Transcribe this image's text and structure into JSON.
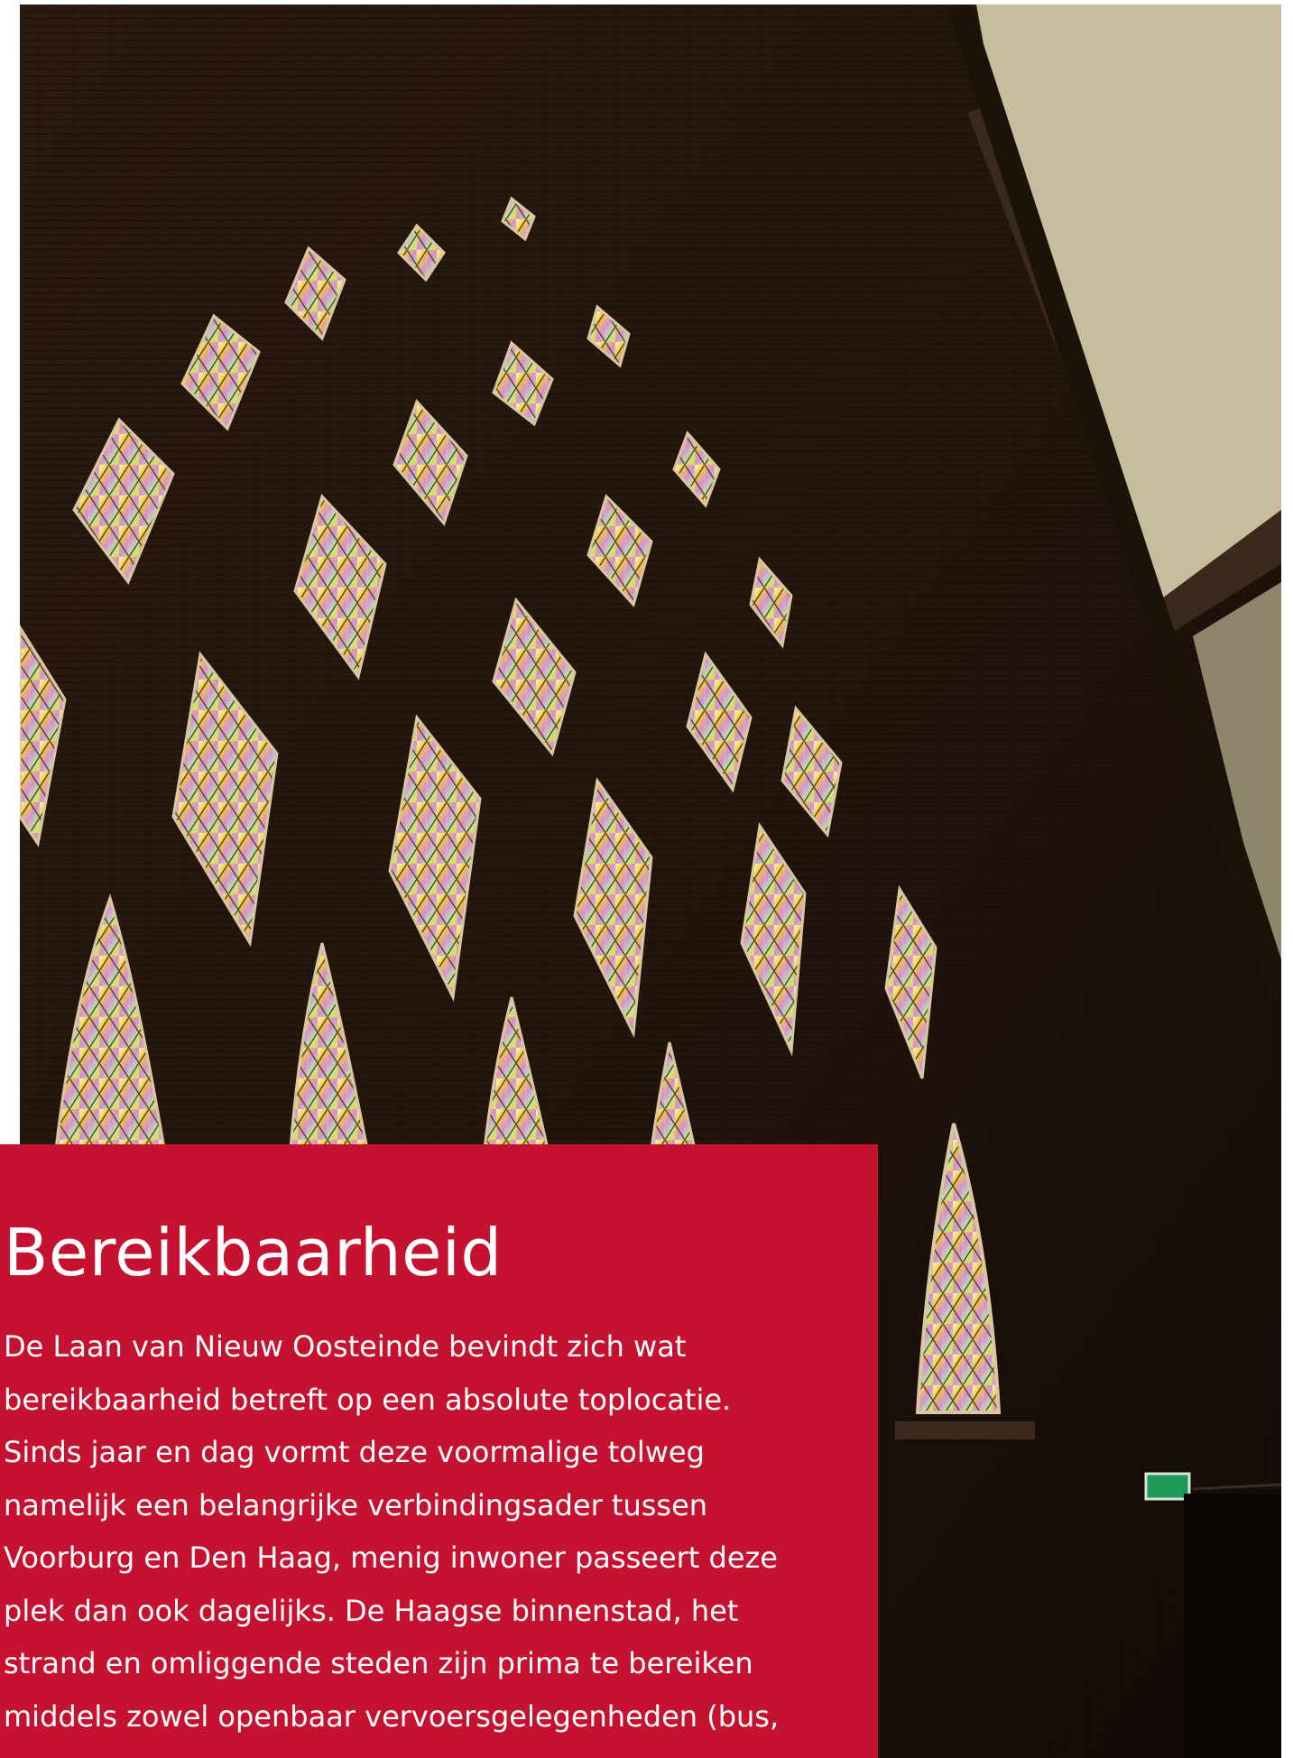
{
  "section": {
    "title": "Bereikbaarheid",
    "body_lines": [
      "De Laan van Nieuw Oosteinde bevindt zich wat",
      "bereikbaarheid betreft op een absolute toplocatie.",
      "Sinds jaar en dag vormt deze voormalige tolweg",
      "namelijk een belangrijke verbindingsader tussen",
      "Voorburg en Den Haag, menig inwoner passeert deze",
      "plek dan ook dagelijks. De Haagse binnenstad, het",
      "strand en omliggende steden zijn prima te bereiken",
      "middels zowel openbaar vervoersgelegenheden (bus,"
    ]
  },
  "colors": {
    "card_background": "#c41230",
    "text": "#ffffff",
    "brick_dark": "#1d120b"
  },
  "image": {
    "subject_icon": "stained-glass-church-window-photo"
  }
}
